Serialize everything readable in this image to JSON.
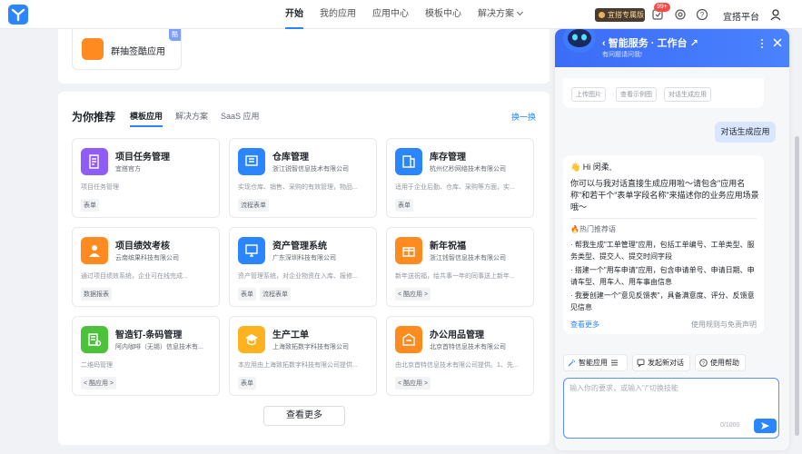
{
  "nav": {
    "items": [
      "开始",
      "我的应用",
      "应用中心",
      "模板中心",
      "解决方案"
    ],
    "active_index": 0
  },
  "topbar": {
    "vip_label": "宜搭专属版",
    "badge": "99+",
    "platform": "宜搭平台",
    "icons": [
      "notification-icon",
      "settings-icon",
      "help-icon",
      "user-avatar-icon"
    ]
  },
  "top_card": {
    "app_name": "群抽签酷应用",
    "corner_tag": "酷"
  },
  "recommend": {
    "title": "为你推荐",
    "tabs": [
      "模板应用",
      "解决方案",
      "SaaS 应用"
    ],
    "active_tab": 0,
    "swap_label": "换一换",
    "more_label": "查看更多",
    "cards": [
      {
        "name": "项目任务管理",
        "company": "宜搭官方",
        "desc": "项目任务管理",
        "tags": [
          "表单"
        ],
        "color": "#8f5cf5",
        "icon": "form-icon"
      },
      {
        "name": "仓库管理",
        "company": "浙江锐智信息技术有限公司",
        "desc": "实现仓库、销售、采购的有效管理，物品...",
        "tags": [
          "流程表单"
        ],
        "color": "#2b85ff",
        "icon": "warehouse-icon"
      },
      {
        "name": "库存管理",
        "company": "杭州亿秒网络技术有限公司",
        "desc": "适用于企业后勤、仓库、采购等方面，实...",
        "tags": [
          "表单"
        ],
        "color": "#2b85ff",
        "icon": "inventory-icon"
      },
      {
        "name": "项目绩效考核",
        "company": "云南缤果科技有限公司",
        "desc": "通过项目绩效系统，企业可在线完成...",
        "tags": [
          "数据报表"
        ],
        "color": "#ff8a1f",
        "icon": "person-icon"
      },
      {
        "name": "资产管理系统",
        "company": "广东深圳科技有限公司",
        "desc": "资产管理系统，对企业物资在入库、报修...",
        "tags": [
          "表单",
          "流程表单"
        ],
        "color": "#2b85ff",
        "icon": "monitor-icon"
      },
      {
        "name": "新年祝福",
        "company": "浙江钱智信息技术有限公司",
        "desc": "新年送祝福，给共事一年的同事送上新年...",
        "tags": [
          "< 酷应用 >"
        ],
        "color": "#ff8a1f",
        "icon": "gift-icon"
      },
      {
        "name": "智造钉-条码管理",
        "company": "阿内咖啡（无锡）信息技术有...",
        "desc": "二维码管理",
        "tags": [
          "< 酷应用 >"
        ],
        "color": "#4cc23a",
        "icon": "barcode-icon"
      },
      {
        "name": "生产工单",
        "company": "上海致拓数字科技有限公司",
        "desc": "本应用由上海致拓数字科技有限公司提供...",
        "tags": [
          "表单"
        ],
        "color": "#ffb21f",
        "icon": "graduation-icon"
      },
      {
        "name": "办公用品管理",
        "company": "北京首特信息技术有限公司",
        "desc": "由北京首特信息技术有限公司提供。1、先...",
        "tags": [
          "< 酷应用 >"
        ],
        "color": "#ff8a1f",
        "icon": "office-icon"
      }
    ]
  },
  "assistant": {
    "title": "智能服务 · 工作台",
    "subtitle": "有问题请问我!",
    "top_chips": [
      "上传图片",
      "查看示例图",
      "对话生成应用"
    ],
    "user_message": "对话生成应用",
    "greeting": "👋 Hi 闵柔,",
    "intro": "你可以与我对话直接生成应用啦～请包含\"应用名称\"和若干个\"表单字段名称\"来描述你的业务应用场景哦～",
    "hot_title": "🔥热门推荐语",
    "suggestions": [
      "· 帮我生成\"工单管理\"应用，包括工单编号、工单类型、服务类型、提交人、提交时间字段",
      "· 搭建一个\"用车申请\"应用，包含申请单号、申请日期、申请车型、用车人、用车事由信息",
      "· 我要创建一个\"意见反馈表\"，具备满意度、评分、反馈意见信息"
    ],
    "more_label": "查看更多",
    "tips_label": "使用规则与免责声明",
    "actions": [
      "智能应用",
      "发起新对话",
      "使用帮助"
    ],
    "input_placeholder": "输入你的要求，或输入\"/\"切换技能",
    "counter": "0/1000"
  }
}
